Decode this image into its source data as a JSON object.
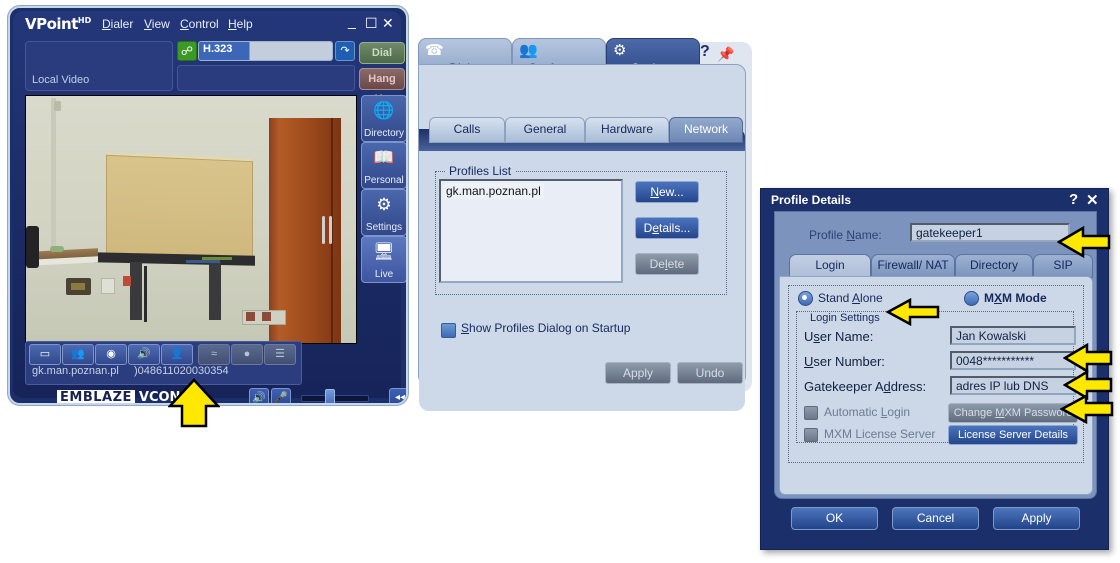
{
  "colors": {
    "window_blue": "#1b2f6b",
    "panel_blue": "#cdd9e9",
    "accent_arrow": "#ffe800",
    "dialog_face": "#7b93bd"
  },
  "vpoint": {
    "logo": "VPoint",
    "logo_suffix": "HD",
    "menus": [
      {
        "label": "Dialer",
        "accel": "D"
      },
      {
        "label": "View",
        "accel": "V"
      },
      {
        "label": "Control",
        "accel": "C"
      },
      {
        "label": "Help",
        "accel": "H"
      }
    ],
    "window_buttons": [
      {
        "name": "minimize",
        "glyph": "_"
      },
      {
        "name": "maximize",
        "glyph": "❐"
      },
      {
        "name": "close",
        "glyph": "✕"
      }
    ],
    "local_video_label": "Local Video",
    "dial": {
      "protocol": "H.323",
      "value": "",
      "placeholder": "",
      "protocol_icon": "call-protocol-icon",
      "go_icon": "dial-go-icon",
      "dial_button": "Dial",
      "hangup_button": "Hang Up"
    },
    "sidebar": [
      {
        "label": "Directory",
        "icon": "globe-directory-icon"
      },
      {
        "label": "Personal",
        "icon": "address-book-icon"
      },
      {
        "label": "Settings",
        "icon": "gear-wrench-icon"
      },
      {
        "label": "Live",
        "icon": "live-monitor-icon"
      }
    ],
    "video_toolbar": [
      {
        "name": "layout-pip-icon",
        "glyph": "▭"
      },
      {
        "name": "contacts-icon",
        "glyph": "⚇"
      },
      {
        "name": "snapshot-camera-icon",
        "glyph": "◉"
      },
      {
        "name": "audio-settings-icon",
        "glyph": "♪"
      },
      {
        "name": "presentation-icon",
        "glyph": "⚙"
      },
      {
        "name": "brightness-icon",
        "glyph": "≈",
        "dim": true
      },
      {
        "name": "contrast-icon",
        "glyph": "●",
        "dim": true
      },
      {
        "name": "list-icon",
        "glyph": "☰",
        "dim": true
      }
    ],
    "status_name": "gk.man.poznan.pl",
    "status_number": ")048611020030354",
    "brand_left": "EMBLAZE",
    "brand_right": "VCON",
    "audio": {
      "speaker_icon": "speaker-icon",
      "mic_icon": "microphone-icon",
      "volume_percent": 55,
      "collapse_icon": "collapse-left-icon"
    }
  },
  "settings": {
    "main_tabs": [
      {
        "label": "Dialer",
        "icon": "phone-handset-icon",
        "active": false
      },
      {
        "label": "Conference",
        "icon": "people-conference-icon",
        "active": false
      },
      {
        "label": "Settings",
        "icon": "gear-wrench-icon",
        "active": true
      }
    ],
    "help_glyph": "?",
    "pin_icon": "pushpin-icon",
    "sub_tabs": [
      {
        "label": "Calls",
        "active": false
      },
      {
        "label": "General",
        "active": false
      },
      {
        "label": "Hardware",
        "active": false
      },
      {
        "label": "Network",
        "active": true
      }
    ],
    "profiles_group": "Profiles List",
    "profiles": [
      "gk.man.poznan.pl"
    ],
    "buttons": {
      "new": "New...",
      "details": "Details...",
      "delete": "Delete",
      "apply": "Apply",
      "undo": "Undo"
    },
    "show_profiles_checkbox": "Show Profiles Dialog on Startup",
    "show_profiles_checked": true
  },
  "profile_dialog": {
    "title": "Profile Details",
    "help_glyph": "?",
    "close_glyph": "✕",
    "profile_name_label": "Profile Name:",
    "profile_name_value": "gatekeeper1",
    "tabs": [
      {
        "label": "Login",
        "active": true
      },
      {
        "label": "Firewall/ NAT",
        "active": false
      },
      {
        "label": "Directory",
        "active": false
      },
      {
        "label": "SIP",
        "active": false
      }
    ],
    "mode": {
      "stand_alone": "Stand Alone",
      "mxm_mode": "MXM Mode",
      "selected": "stand_alone"
    },
    "login_settings_legend": "Login Settings",
    "fields": [
      {
        "label": "User Name:",
        "value": "Jan Kowalski"
      },
      {
        "label": "User Number:",
        "value": "0048***********"
      },
      {
        "label": "Gatekeeper Address:",
        "value": "adres IP lub DNS"
      }
    ],
    "checkboxes": [
      {
        "label": "Automatic Login",
        "checked": false,
        "disabled": true
      },
      {
        "label": "MXM License Server",
        "checked": false,
        "disabled": true
      }
    ],
    "mxm_buttons": {
      "change_password": "Change MXM Password",
      "license_details": "License Server Details"
    },
    "footer_buttons": {
      "ok": "OK",
      "cancel": "Cancel",
      "apply": "Apply"
    }
  },
  "annotations": [
    {
      "name": "arrow-video-status",
      "direction": "up"
    },
    {
      "name": "arrow-profile-name",
      "direction": "left"
    },
    {
      "name": "arrow-stand-alone",
      "direction": "left"
    },
    {
      "name": "arrow-user-name",
      "direction": "left"
    },
    {
      "name": "arrow-user-number",
      "direction": "left"
    },
    {
      "name": "arrow-gatekeeper-address",
      "direction": "left"
    }
  ]
}
